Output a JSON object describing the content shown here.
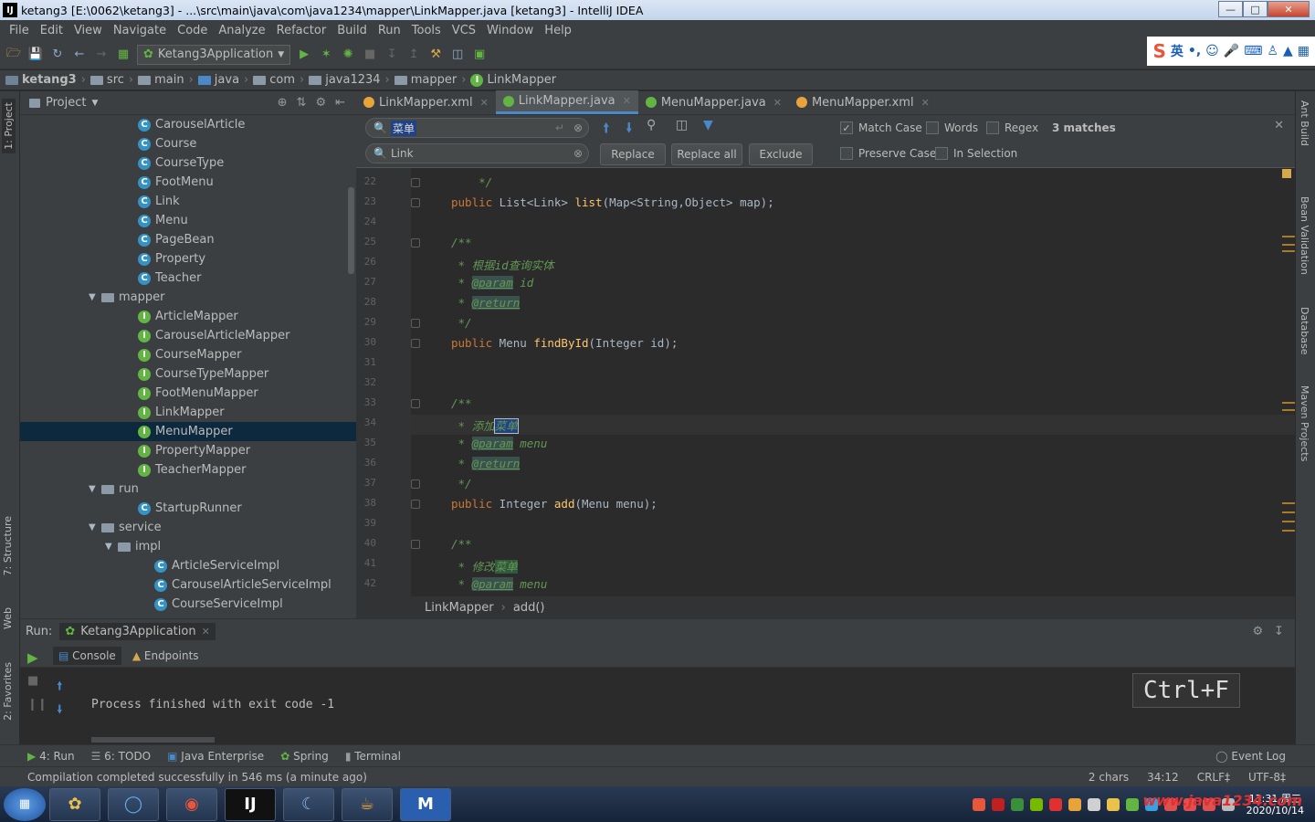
{
  "window": {
    "title": "ketang3 [E:\\0062\\ketang3] - ...\\src\\main\\java\\com\\java1234\\mapper\\LinkMapper.java [ketang3] - IntelliJ IDEA"
  },
  "menu": [
    "File",
    "Edit",
    "View",
    "Navigate",
    "Code",
    "Analyze",
    "Refactor",
    "Build",
    "Run",
    "Tools",
    "VCS",
    "Window",
    "Help"
  ],
  "toolbar": {
    "run_config": "Ketang3Application"
  },
  "ime": {
    "label": "英"
  },
  "breadcrumbs": [
    "ketang3",
    "src",
    "main",
    "java",
    "com",
    "java1234",
    "mapper",
    "LinkMapper"
  ],
  "project": {
    "title": "Project",
    "items": [
      {
        "label": "CarouselArticle",
        "kind": "c",
        "indent": 129
      },
      {
        "label": "Course",
        "kind": "c",
        "indent": 129
      },
      {
        "label": "CourseType",
        "kind": "c",
        "indent": 129
      },
      {
        "label": "FootMenu",
        "kind": "c",
        "indent": 129
      },
      {
        "label": "Link",
        "kind": "c",
        "indent": 129
      },
      {
        "label": "Menu",
        "kind": "c",
        "indent": 129
      },
      {
        "label": "PageBean",
        "kind": "c",
        "indent": 129
      },
      {
        "label": "Property",
        "kind": "c",
        "indent": 129
      },
      {
        "label": "Teacher",
        "kind": "c",
        "indent": 129
      },
      {
        "label": "mapper",
        "kind": "folder",
        "indent": 93
      },
      {
        "label": "ArticleMapper",
        "kind": "i",
        "indent": 129
      },
      {
        "label": "CarouselArticleMapper",
        "kind": "i",
        "indent": 129
      },
      {
        "label": "CourseMapper",
        "kind": "i",
        "indent": 129
      },
      {
        "label": "CourseTypeMapper",
        "kind": "i",
        "indent": 129
      },
      {
        "label": "FootMenuMapper",
        "kind": "i",
        "indent": 129
      },
      {
        "label": "LinkMapper",
        "kind": "i",
        "indent": 129
      },
      {
        "label": "MenuMapper",
        "kind": "i",
        "indent": 129,
        "selected": true
      },
      {
        "label": "PropertyMapper",
        "kind": "i",
        "indent": 129
      },
      {
        "label": "TeacherMapper",
        "kind": "i",
        "indent": 129
      },
      {
        "label": "run",
        "kind": "folder",
        "indent": 93
      },
      {
        "label": "StartupRunner",
        "kind": "c",
        "indent": 129
      },
      {
        "label": "service",
        "kind": "folder",
        "indent": 93
      },
      {
        "label": "impl",
        "kind": "folder",
        "indent": 111
      },
      {
        "label": "ArticleServiceImpl",
        "kind": "c",
        "indent": 147
      },
      {
        "label": "CarouselArticleServiceImpl",
        "kind": "c",
        "indent": 147
      },
      {
        "label": "CourseServiceImpl",
        "kind": "c",
        "indent": 147
      }
    ]
  },
  "tabs": [
    {
      "label": "LinkMapper.xml",
      "color": "#e8a33b"
    },
    {
      "label": "LinkMapper.java",
      "color": "#62b543",
      "active": true
    },
    {
      "label": "MenuMapper.java",
      "color": "#62b543"
    },
    {
      "label": "MenuMapper.xml",
      "color": "#e8a33b"
    }
  ],
  "find": {
    "search_value": "菜单",
    "replace_value": "Link",
    "match_case": "Match Case",
    "words": "Words",
    "regex": "Regex",
    "matches": "3 matches",
    "replace": "Replace",
    "replace_all": "Replace all",
    "exclude": "Exclude",
    "preserve_case": "Preserve Case",
    "in_selection": "In Selection"
  },
  "code": {
    "lines": [
      {
        "n": "22",
        "t": "    */"
      },
      {
        "n": "23",
        "t": "public List<Link> list(Map<String,Object> map);"
      },
      {
        "n": "24",
        "t": ""
      },
      {
        "n": "25",
        "t": "/**"
      },
      {
        "n": "26",
        "t": " * 根据id查询实体"
      },
      {
        "n": "27",
        "t": " * @param id"
      },
      {
        "n": "28",
        "t": " * @return"
      },
      {
        "n": "29",
        "t": " */"
      },
      {
        "n": "30",
        "t": "public Menu findById(Integer id);"
      },
      {
        "n": "31",
        "t": ""
      },
      {
        "n": "32",
        "t": ""
      },
      {
        "n": "33",
        "t": "/**"
      },
      {
        "n": "34",
        "t": " * 添加菜单"
      },
      {
        "n": "35",
        "t": " * @param menu"
      },
      {
        "n": "36",
        "t": " * @return"
      },
      {
        "n": "37",
        "t": " */"
      },
      {
        "n": "38",
        "t": "public Integer add(Menu menu);"
      },
      {
        "n": "39",
        "t": ""
      },
      {
        "n": "40",
        "t": "/**"
      },
      {
        "n": "41",
        "t": " * 修改菜单"
      },
      {
        "n": "42",
        "t": " * @param menu"
      }
    ]
  },
  "editor_breadcrumb": {
    "cls": "LinkMapper",
    "method": "add()"
  },
  "run": {
    "label": "Run:",
    "config": "Ketang3Application",
    "console_tab": "Console",
    "endpoints_tab": "Endpoints",
    "output": "Process finished with exit code -1",
    "key_hint": "Ctrl+F"
  },
  "right_strip": [
    "Ant Build",
    "Bean Validation",
    "Database",
    "Maven Projects"
  ],
  "left_strip": [
    "1: Project",
    "7: Structure",
    "Web",
    "2: Favorites"
  ],
  "toolwindows": {
    "run": "4: Run",
    "todo": "6: TODO",
    "java_enterprise": "Java Enterprise",
    "spring": "Spring",
    "terminal": "Terminal",
    "event_log": "Event Log"
  },
  "status": {
    "message": "Compilation completed successfully in 546 ms (a minute ago)",
    "chars": "2 chars",
    "pos": "34:12",
    "crlf": "CRLF‡",
    "encoding": "UTF-8‡"
  },
  "taskbar": {
    "time": "13:31 周三",
    "date": "2020/10/14",
    "watermark": "www.java1234.com"
  }
}
